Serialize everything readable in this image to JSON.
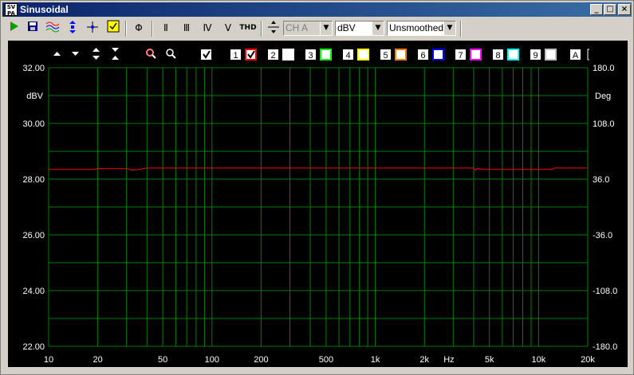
{
  "window": {
    "icon_text": "SV\nPA",
    "title": "Sinusoidal"
  },
  "titlebar_buttons": [
    "_",
    "□",
    "×"
  ],
  "toolbar": {
    "thd_label": "THD",
    "channel_select": "CH A",
    "unit_select": "dBV",
    "smoothing_select": "Unsmoothed",
    "cursor_glyphs": [
      "Φ",
      "Ⅱ",
      "Ⅲ",
      "Ⅳ",
      "Ⅴ"
    ]
  },
  "plot_controls": {
    "channels": [
      {
        "num": "1",
        "color": "#ff0000",
        "checked": true
      },
      {
        "num": "2",
        "color": "#ffffff",
        "checked": false
      },
      {
        "num": "3",
        "color": "#00ff00",
        "checked": false
      },
      {
        "num": "4",
        "color": "#ffff00",
        "checked": false
      },
      {
        "num": "5",
        "color": "#ff8000",
        "checked": false
      },
      {
        "num": "6",
        "color": "#0000ff",
        "checked": false
      },
      {
        "num": "7",
        "color": "#ff00ff",
        "checked": false
      },
      {
        "num": "8",
        "color": "#00ffff",
        "checked": false
      },
      {
        "num": "9",
        "color": "#c0c0c0",
        "checked": false
      }
    ],
    "a_label": "A"
  },
  "chart_data": {
    "type": "line",
    "xscale": "log",
    "xlim": [
      10,
      20000
    ],
    "ylim": [
      22,
      32
    ],
    "y2lim": [
      -180,
      180
    ],
    "ylabel": "dBV",
    "y2label": "Deg",
    "xunit": "Hz",
    "grid": true,
    "x_ticks": [
      {
        "v": 10,
        "label": "10"
      },
      {
        "v": 20,
        "label": "20"
      },
      {
        "v": 50,
        "label": "50"
      },
      {
        "v": 100,
        "label": "100"
      },
      {
        "v": 200,
        "label": "200"
      },
      {
        "v": 500,
        "label": "500"
      },
      {
        "v": 1000,
        "label": "1k"
      },
      {
        "v": 2000,
        "label": "2k"
      },
      {
        "v": 5000,
        "label": "5k"
      },
      {
        "v": 10000,
        "label": "10k"
      },
      {
        "v": 20000,
        "label": "20k"
      }
    ],
    "y_ticks": [
      "32.00",
      "30.00",
      "28.00",
      "26.00",
      "24.00",
      "22.00"
    ],
    "y2_ticks": [
      "180.0",
      "108.0",
      "36.0",
      "-36.0",
      "-108.0",
      "-180.0"
    ],
    "colors": {
      "grid": "#008000",
      "text": "#ffffff",
      "background": "#000000"
    },
    "series": [
      {
        "color": "#ff0000",
        "x": [
          10,
          19,
          20,
          30,
          32,
          34,
          40,
          100,
          1000,
          4000,
          4100,
          4200,
          4600,
          5000,
          9000,
          12000,
          12500,
          13000,
          20000
        ],
        "y": [
          28.35,
          28.35,
          28.38,
          28.38,
          28.33,
          28.33,
          28.4,
          28.4,
          28.4,
          28.4,
          28.32,
          28.38,
          28.35,
          28.35,
          28.35,
          28.35,
          28.4,
          28.4,
          28.4
        ]
      }
    ]
  }
}
